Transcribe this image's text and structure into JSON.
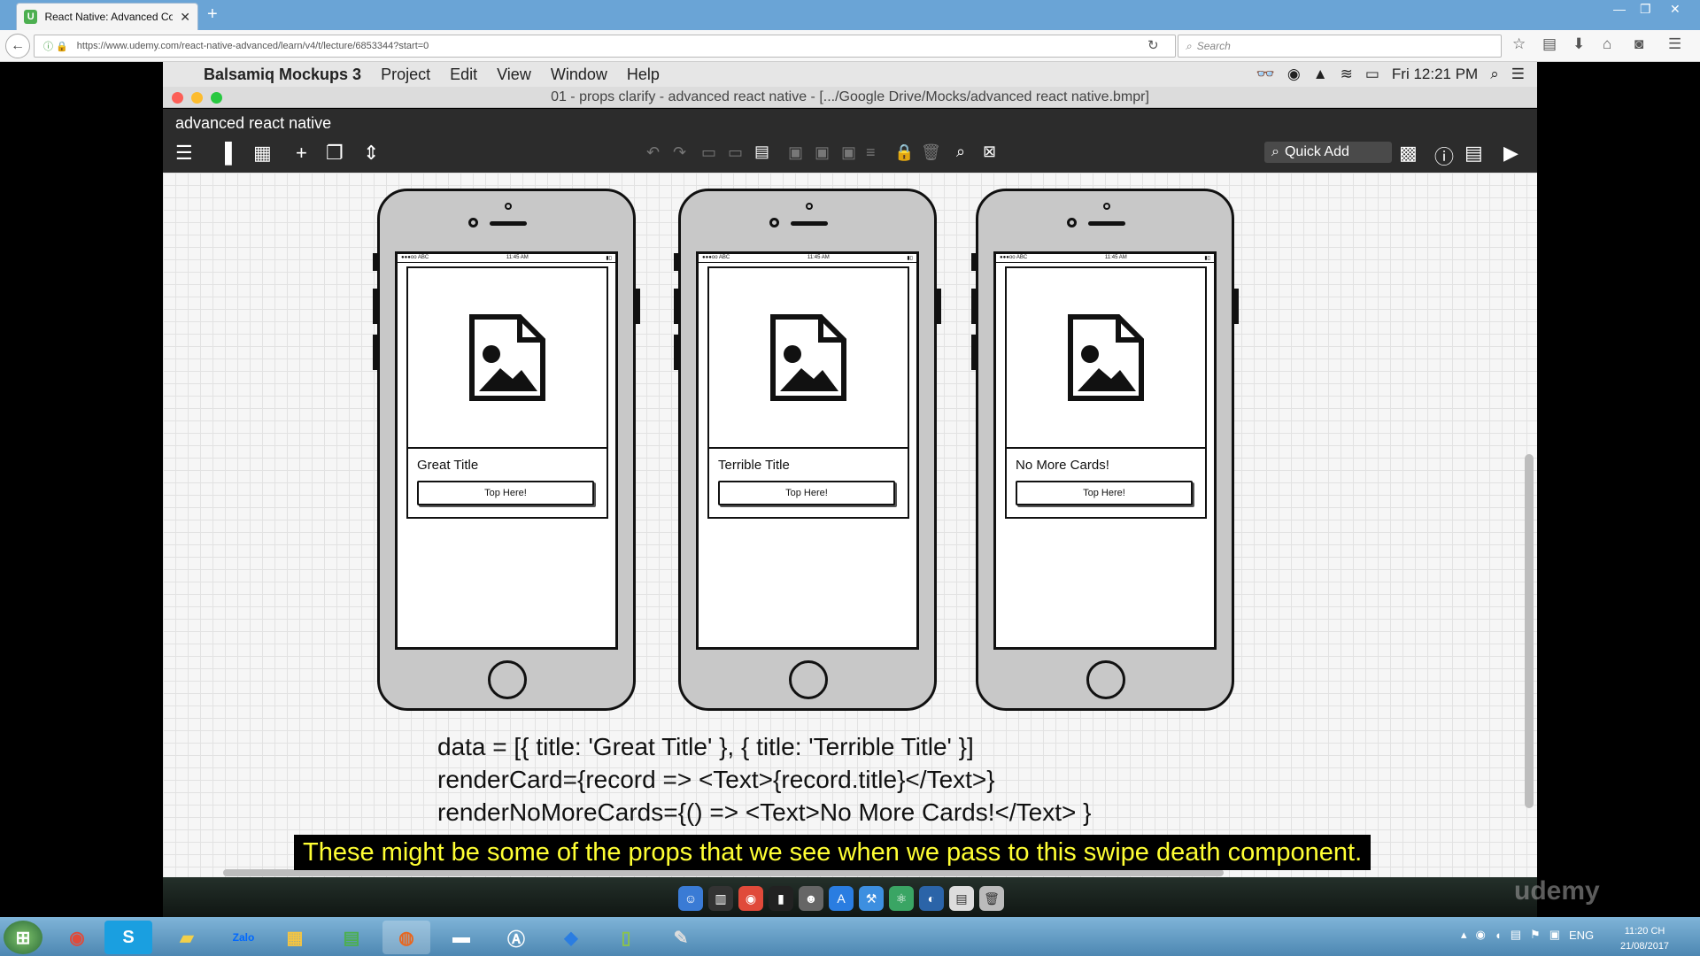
{
  "browser": {
    "tab_title": "React Native: Advanced Con",
    "url": "https://www.udemy.com/react-native-advanced/learn/v4/t/lecture/6853344?start=0",
    "search_placeholder": "Search"
  },
  "mac_menu": {
    "app_name": "Balsamiq Mockups 3",
    "items": [
      "Project",
      "Edit",
      "View",
      "Window",
      "Help"
    ],
    "clock": "Fri 12:21 PM"
  },
  "window_title": "01 - props clarify - advanced react native - [.../Google Drive/Mocks/advanced react native.bmpr]",
  "project_name": "advanced react native",
  "quick_add_label": "Quick Add",
  "phones": [
    {
      "status_left": "●●●oo ABC",
      "status_time": "11:45 AM",
      "card_title": "Great Title",
      "button_label": "Top Here!"
    },
    {
      "status_left": "●●●oo ABC",
      "status_time": "11:45 AM",
      "card_title": "Terrible Title",
      "button_label": "Top Here!"
    },
    {
      "status_left": "●●●oo ABC",
      "status_time": "11:45 AM",
      "card_title": "No More Cards!",
      "button_label": "Top Here!"
    }
  ],
  "code_lines": [
    "data = [{ title: 'Great Title' }, { title: 'Terrible Title' }]",
    "renderCard={record => <Text>{record.title}</Text>}",
    "renderNoMoreCards={() => <Text>No More Cards!</Text> }"
  ],
  "subtitle": "These might be some of the props that we see when we pass to this swipe death component.",
  "watermark": "udemy",
  "taskbar": {
    "language": "ENG",
    "time": "11:20 CH",
    "date": "21/08/2017"
  },
  "colors": {
    "titlebar": "#6aa4d6",
    "subtitle_text": "#ffff33",
    "toolbar_bg": "#2c2c2c"
  }
}
